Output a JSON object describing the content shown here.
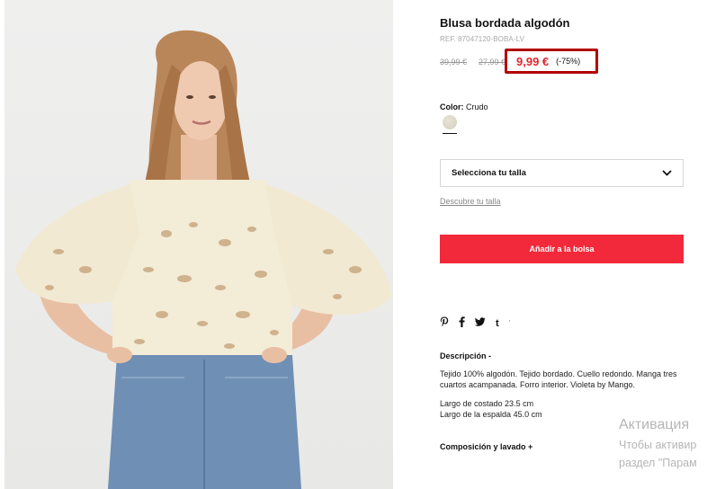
{
  "product": {
    "title": "Blusa bordada algodón",
    "ref": "REF. 87047120-BOBA-LV",
    "prices": {
      "original": "39,99 €",
      "previous": "27,99 €",
      "current": "9,99 €",
      "discount": "(-75%)"
    },
    "color": {
      "label": "Color:",
      "value": "Crudo",
      "swatch_color": "#ddd8c6"
    },
    "size_select": {
      "label": "Selecciona tu talla",
      "icon": "chevron-down-icon"
    },
    "size_guide": "Descubre tu talla",
    "add_button": "Añadir a la bolsa",
    "social": {
      "pinterest": "P",
      "facebook": "f",
      "twitter": "t",
      "tumblr": "t",
      "extra": "'"
    },
    "description": {
      "title": "Descripción  -",
      "text": "Tejido 100% algodón. Tejido bordado. Cuello redondo. Manga tres cuartos acampanada. Forro interior. Violeta by Mango.",
      "length_side": "Largo de costado 23.5 cm",
      "length_back": "Largo de la espalda 45.0 cm"
    },
    "composition": "Composición y lavado  +"
  },
  "watermark": {
    "line1": "Активация",
    "line2": "Чтобы активир",
    "line3": "раздел \"Парам"
  },
  "colors": {
    "accent": "#f2293a",
    "sale": "#e3232b",
    "highlight_border": "#b30000"
  }
}
